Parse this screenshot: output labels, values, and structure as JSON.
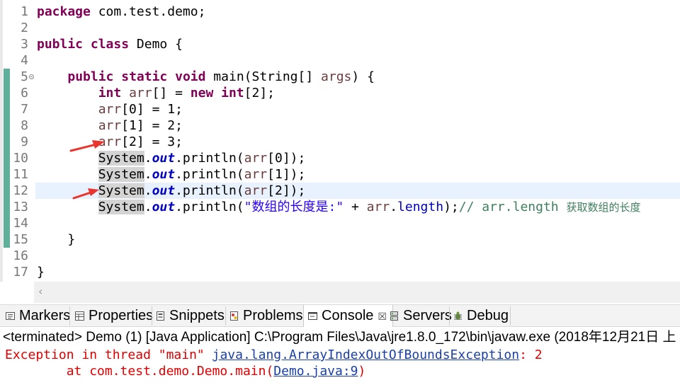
{
  "editor": {
    "lines": [
      {
        "n": "1",
        "segments": [
          {
            "t": "package",
            "c": "kw"
          },
          {
            "t": " com.test.demo;",
            "c": ""
          }
        ]
      },
      {
        "n": "2",
        "segments": []
      },
      {
        "n": "3",
        "segments": [
          {
            "t": "public",
            "c": "kw"
          },
          {
            "t": " ",
            "c": ""
          },
          {
            "t": "class",
            "c": "kw"
          },
          {
            "t": " Demo {",
            "c": ""
          }
        ]
      },
      {
        "n": "4",
        "segments": []
      },
      {
        "n": "5",
        "fold": true,
        "segments": [
          {
            "t": "    ",
            "c": ""
          },
          {
            "t": "public",
            "c": "kw"
          },
          {
            "t": " ",
            "c": ""
          },
          {
            "t": "static",
            "c": "kw"
          },
          {
            "t": " ",
            "c": ""
          },
          {
            "t": "void",
            "c": "kw"
          },
          {
            "t": " main(String[] ",
            "c": ""
          },
          {
            "t": "args",
            "c": "var"
          },
          {
            "t": ") {",
            "c": ""
          }
        ]
      },
      {
        "n": "6",
        "segments": [
          {
            "t": "        ",
            "c": ""
          },
          {
            "t": "int",
            "c": "kw"
          },
          {
            "t": " ",
            "c": ""
          },
          {
            "t": "arr",
            "c": "var"
          },
          {
            "t": "[] = ",
            "c": ""
          },
          {
            "t": "new",
            "c": "kw"
          },
          {
            "t": " ",
            "c": ""
          },
          {
            "t": "int",
            "c": "kw"
          },
          {
            "t": "[2];",
            "c": ""
          }
        ]
      },
      {
        "n": "7",
        "segments": [
          {
            "t": "        ",
            "c": ""
          },
          {
            "t": "arr",
            "c": "var"
          },
          {
            "t": "[0] = 1;",
            "c": ""
          }
        ]
      },
      {
        "n": "8",
        "segments": [
          {
            "t": "        ",
            "c": ""
          },
          {
            "t": "arr",
            "c": "var"
          },
          {
            "t": "[1] = 2;",
            "c": ""
          }
        ]
      },
      {
        "n": "9",
        "segments": [
          {
            "t": "        ",
            "c": ""
          },
          {
            "t": "arr",
            "c": "var"
          },
          {
            "t": "[2] = 3;",
            "c": ""
          }
        ]
      },
      {
        "n": "10",
        "segments": [
          {
            "t": "        ",
            "c": ""
          },
          {
            "t": "System",
            "c": "hl"
          },
          {
            "t": ".",
            "c": ""
          },
          {
            "t": "out",
            "c": "sfld"
          },
          {
            "t": ".println(",
            "c": ""
          },
          {
            "t": "arr",
            "c": "var"
          },
          {
            "t": "[0]);",
            "c": ""
          }
        ]
      },
      {
        "n": "11",
        "segments": [
          {
            "t": "        ",
            "c": ""
          },
          {
            "t": "System",
            "c": "hl"
          },
          {
            "t": ".",
            "c": ""
          },
          {
            "t": "out",
            "c": "sfld"
          },
          {
            "t": ".println(",
            "c": ""
          },
          {
            "t": "arr",
            "c": "var"
          },
          {
            "t": "[1]);",
            "c": ""
          }
        ]
      },
      {
        "n": "12",
        "current": true,
        "segments": [
          {
            "t": "        ",
            "c": ""
          },
          {
            "t": "System",
            "c": "hl"
          },
          {
            "t": ".",
            "c": ""
          },
          {
            "t": "out",
            "c": "sfld"
          },
          {
            "t": ".println(",
            "c": ""
          },
          {
            "t": "arr",
            "c": "var"
          },
          {
            "t": "[2]);",
            "c": ""
          }
        ]
      },
      {
        "n": "13",
        "segments": [
          {
            "t": "        ",
            "c": ""
          },
          {
            "t": "System",
            "c": "hl"
          },
          {
            "t": ".",
            "c": ""
          },
          {
            "t": "out",
            "c": "sfld"
          },
          {
            "t": ".println(",
            "c": ""
          },
          {
            "t": "\"数组的长度是:\"",
            "c": "str"
          },
          {
            "t": " + ",
            "c": ""
          },
          {
            "t": "arr",
            "c": "var"
          },
          {
            "t": ".",
            "c": ""
          },
          {
            "t": "length",
            "c": "fld"
          },
          {
            "t": ");",
            "c": ""
          },
          {
            "t": "// arr.length ",
            "c": "cmt"
          },
          {
            "t": "获取数组的长度",
            "c": "cmt cjk"
          }
        ]
      },
      {
        "n": "14",
        "segments": []
      },
      {
        "n": "15",
        "segments": [
          {
            "t": "    }",
            "c": ""
          }
        ]
      },
      {
        "n": "16",
        "segments": []
      },
      {
        "n": "17",
        "segments": [
          {
            "t": "}",
            "c": ""
          }
        ]
      }
    ],
    "annotation_color": "#e8352e"
  },
  "views": {
    "tabs": [
      {
        "label": "Markers",
        "icon": "markers-icon"
      },
      {
        "label": "Properties",
        "icon": "properties-icon"
      },
      {
        "label": "Snippets",
        "icon": "snippets-icon"
      },
      {
        "label": "Problems",
        "icon": "problems-icon"
      },
      {
        "label": "Console",
        "icon": "console-icon",
        "active": true,
        "close": "☒"
      },
      {
        "label": "Servers",
        "icon": "servers-icon"
      },
      {
        "label": "Debug",
        "icon": "debug-icon"
      }
    ]
  },
  "console": {
    "description": "<terminated> Demo (1) [Java Application] C:\\Program Files\\Java\\jre1.8.0_172\\bin\\javaw.exe (2018年12月21日 上",
    "line1_prefix": "Exception in thread \"main\" ",
    "line1_exception": "java.lang.ArrayIndexOutOfBoundsException",
    "line1_suffix": ": 2",
    "line2_prefix": "        at com.test.demo.Demo.main(",
    "line2_link": "Demo.java:9",
    "line2_suffix": ")"
  },
  "colors": {
    "keyword": "#7f0055",
    "local_variable": "#6a3e3e",
    "field": "#0000c0",
    "string": "#2a00ff",
    "comment": "#3f7f5f",
    "console_error": "#e00000"
  }
}
